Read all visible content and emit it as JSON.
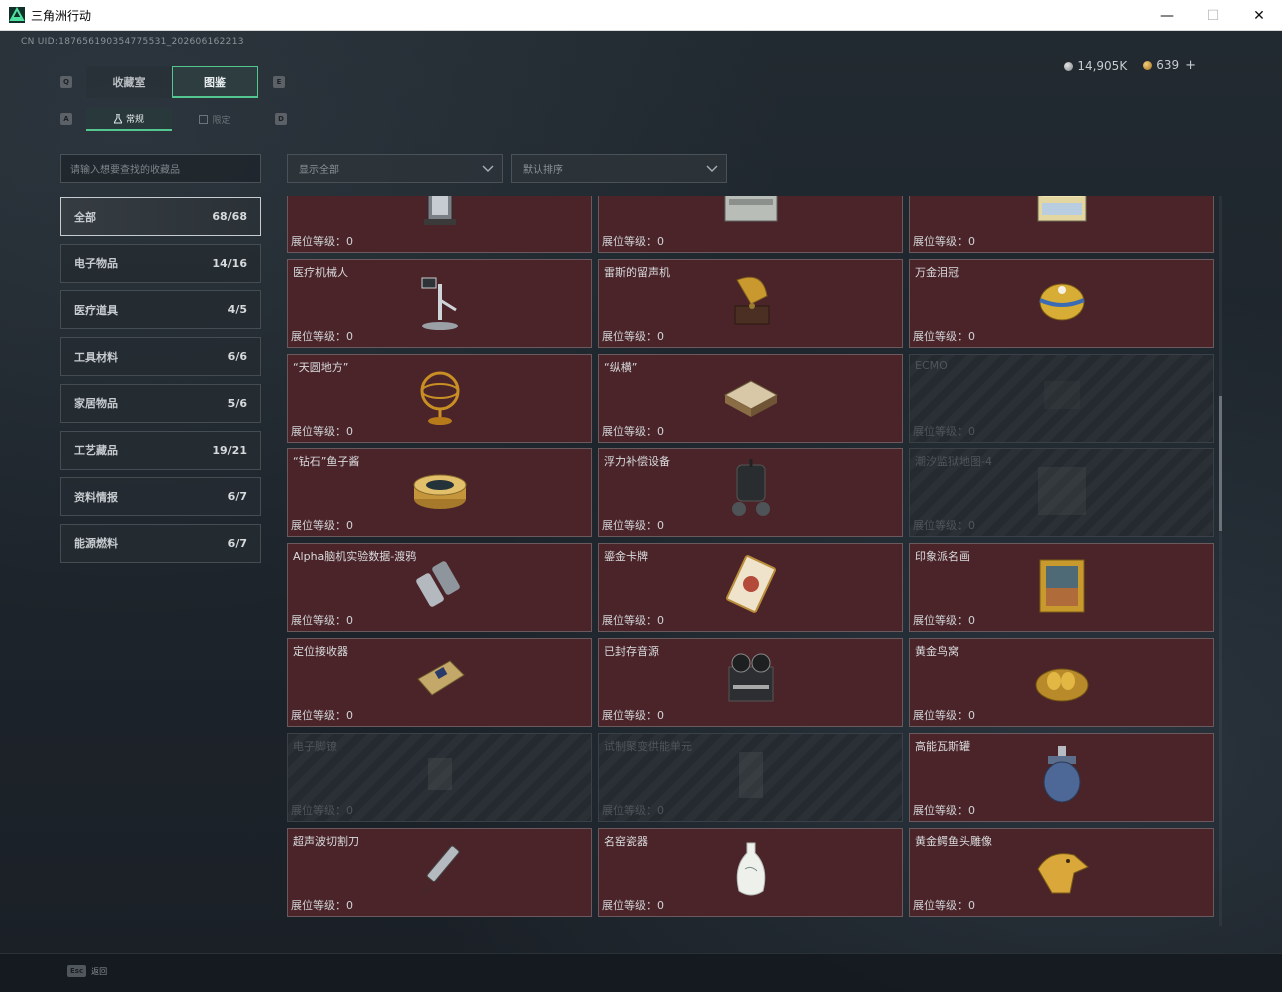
{
  "window": {
    "title": "三角洲行动",
    "controls": {
      "minimize": "—",
      "maximize": "☐",
      "close": "✕"
    }
  },
  "uid": "CN UID:187656190354775531_202606162213",
  "currency": {
    "silver": "14,905K",
    "gold": "639",
    "add": "+"
  },
  "main_tabs": [
    {
      "label": "收藏室",
      "active": false
    },
    {
      "label": "图鉴",
      "active": true
    }
  ],
  "tab_keys": {
    "left": "Q",
    "right": "E"
  },
  "sub_tabs": [
    {
      "label": "常规",
      "active": true
    },
    {
      "label": "限定",
      "active": false
    }
  ],
  "sub_tab_keys": {
    "left": "A",
    "right": "D"
  },
  "search": {
    "placeholder": "请输入想要查找的收藏品"
  },
  "filters": {
    "display": "显示全部",
    "sort": "默认排序"
  },
  "categories": [
    {
      "label": "全部",
      "count": "68/68",
      "active": true
    },
    {
      "label": "电子物品",
      "count": "14/16"
    },
    {
      "label": "医疗道具",
      "count": "4/5"
    },
    {
      "label": "工具材料",
      "count": "6/6"
    },
    {
      "label": "家居物品",
      "count": "5/6"
    },
    {
      "label": "工艺藏品",
      "count": "19/21"
    },
    {
      "label": "资料情报",
      "count": "6/7"
    },
    {
      "label": "能源燃料",
      "count": "6/7"
    }
  ],
  "level_label": "展位等级：",
  "items": [
    {
      "name": "",
      "level": "0",
      "locked": false,
      "icon": "cylinder-device-icon"
    },
    {
      "name": "",
      "level": "0",
      "locked": false,
      "icon": "server-box-icon"
    },
    {
      "name": "",
      "level": "0",
      "locked": false,
      "icon": "battery-pack-icon"
    },
    {
      "name": "医疗机械人",
      "level": "0",
      "locked": false,
      "icon": "medical-robot-icon"
    },
    {
      "name": "雷斯的留声机",
      "level": "0",
      "locked": false,
      "icon": "gramophone-icon"
    },
    {
      "name": "万金泪冠",
      "level": "0",
      "locked": false,
      "icon": "jeweled-egg-icon"
    },
    {
      "name": "“天圆地方”",
      "level": "0",
      "locked": false,
      "icon": "armillary-sphere-icon"
    },
    {
      "name": "“纵横”",
      "level": "0",
      "locked": false,
      "icon": "chess-box-icon"
    },
    {
      "name": "ECMO",
      "level": "0",
      "locked": true,
      "icon": "ecmo-icon"
    },
    {
      "name": "“钻石”鱼子酱",
      "level": "0",
      "locked": false,
      "icon": "caviar-tin-icon"
    },
    {
      "name": "浮力补偿设备",
      "level": "0",
      "locked": false,
      "icon": "buoyancy-device-icon"
    },
    {
      "name": "潮汐监狱地图-4",
      "level": "0",
      "locked": true,
      "icon": "map-icon"
    },
    {
      "name": "Alpha脑机实验数据-渡鸦",
      "level": "0",
      "locked": false,
      "icon": "data-canister-icon"
    },
    {
      "name": "鎏金卡牌",
      "level": "0",
      "locked": false,
      "icon": "gold-card-icon"
    },
    {
      "name": "印象派名画",
      "level": "0",
      "locked": false,
      "icon": "painting-icon"
    },
    {
      "name": "定位接收器",
      "level": "0",
      "locked": false,
      "icon": "receiver-icon"
    },
    {
      "name": "已封存音源",
      "level": "0",
      "locked": false,
      "icon": "tape-recorder-icon"
    },
    {
      "name": "黄金鸟窝",
      "level": "0",
      "locked": false,
      "icon": "gold-nest-icon"
    },
    {
      "name": "电子脚镣",
      "level": "0",
      "locked": true,
      "icon": "ankle-monitor-icon"
    },
    {
      "name": "试制聚变供能单元",
      "level": "0",
      "locked": true,
      "icon": "fusion-cell-icon"
    },
    {
      "name": "高能瓦斯罐",
      "level": "0",
      "locked": false,
      "icon": "gas-tank-icon"
    },
    {
      "name": "超声波切割刀",
      "level": "0",
      "locked": false,
      "icon": "ultrasonic-cutter-icon"
    },
    {
      "name": "名窑瓷器",
      "level": "0",
      "locked": false,
      "icon": "porcelain-vase-icon"
    },
    {
      "name": "黄金鳄鱼头雕像",
      "level": "0",
      "locked": false,
      "icon": "gold-crocodile-icon"
    }
  ],
  "footer": {
    "key": "Esc",
    "label": "返回"
  }
}
